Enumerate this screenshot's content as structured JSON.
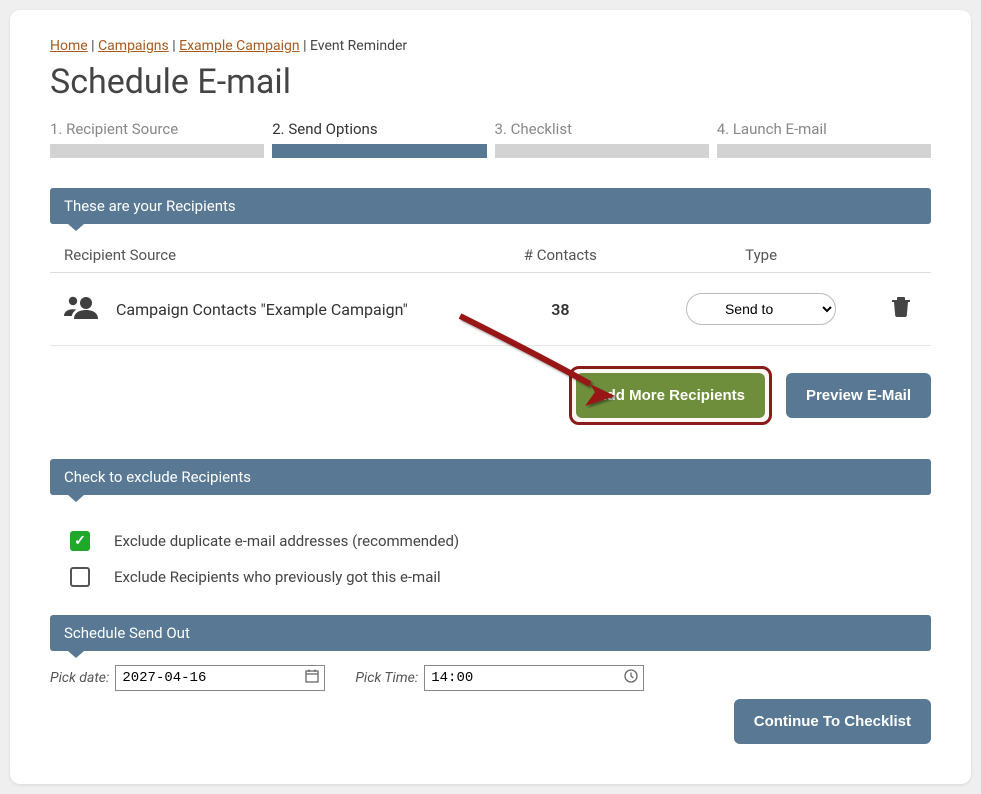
{
  "breadcrumb": {
    "home": "Home",
    "campaigns": "Campaigns",
    "example": "Example Campaign",
    "current": "Event Reminder"
  },
  "page_title": "Schedule E-mail",
  "steps": {
    "s1": "1. Recipient Source",
    "s2": "2. Send Options",
    "s3": "3. Checklist",
    "s4": "4. Launch E-mail"
  },
  "panels": {
    "recipients": "These are your Recipients",
    "exclude": "Check to exclude Recipients",
    "schedule": "Schedule Send Out"
  },
  "table": {
    "h_source": "Recipient Source",
    "h_contacts": "# Contacts",
    "h_type": "Type",
    "row_source": "Campaign Contacts \"Example Campaign\"",
    "row_count": "38",
    "row_type": "Send to"
  },
  "buttons": {
    "add_more": "Add More Recipients",
    "preview": "Preview E-Mail",
    "continue": "Continue To Checklist"
  },
  "exclude": {
    "dup": "Exclude duplicate e-mail addresses (recommended)",
    "prev": "Exclude Recipients who previously got this e-mail"
  },
  "schedule": {
    "date_label": "Pick date:",
    "date_value": "2027-04-16",
    "time_label": "Pick Time:",
    "time_value": "14:00"
  }
}
